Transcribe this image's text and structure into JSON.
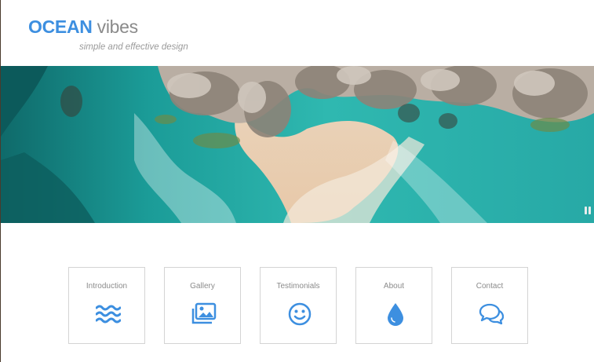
{
  "brand": {
    "primary": "OCEAN",
    "secondary": "vibes",
    "tagline": "simple and effective design"
  },
  "colors": {
    "accent": "#3d8fe0",
    "muted": "#8a8a8a",
    "card_border": "#d4d4d4"
  },
  "hero": {
    "pause_icon": "pause-icon"
  },
  "nav_cards": [
    {
      "label": "Introduction",
      "icon": "waves-icon"
    },
    {
      "label": "Gallery",
      "icon": "images-icon"
    },
    {
      "label": "Testimonials",
      "icon": "smile-icon"
    },
    {
      "label": "About",
      "icon": "water-drop-icon"
    },
    {
      "label": "Contact",
      "icon": "chat-bubbles-icon"
    }
  ]
}
